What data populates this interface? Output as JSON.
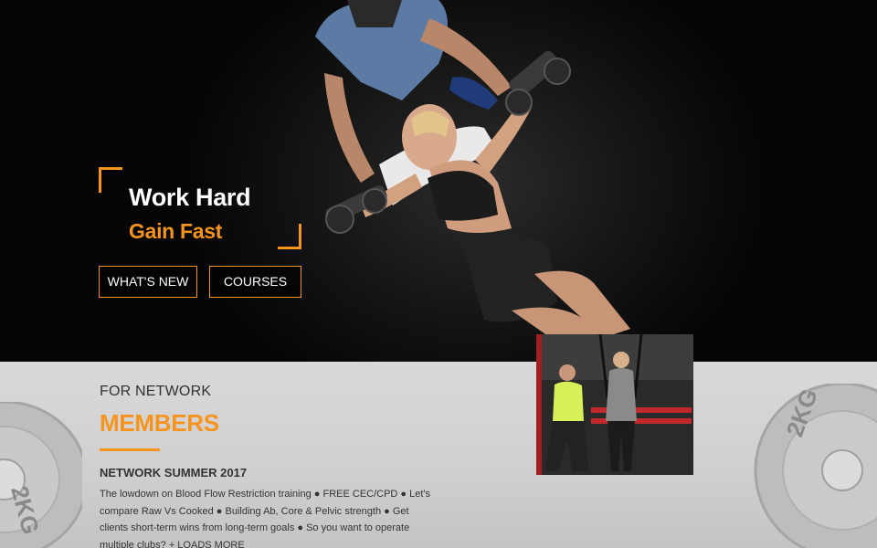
{
  "hero": {
    "headline_line1": "Work Hard",
    "headline_line2": "Gain Fast",
    "buttons": {
      "whats_new": "WHAT'S NEW",
      "courses": "COURSES"
    },
    "photo": "woman-dumbbell-fly-with-trainer-photo"
  },
  "members_section": {
    "kicker": "FOR NETWORK",
    "title": "MEMBERS",
    "issue_title": "NETWORK SUMMER 2017",
    "issue_summary": "The lowdown on Blood Flow Restriction training ● FREE CEC/CPD ● Let's compare Raw Vs Cooked ● Building Ab, Core & Pelvic strength ● Get clients short-term wins from long-term goals ● So you want to operate multiple clubs?",
    "more_link": "+ LOADS MORE",
    "plate_right_label": "2KG",
    "plate_left_label": "2KG",
    "thumbnail": "trx-suspension-training-photo"
  },
  "colors": {
    "accent": "#f7941d",
    "hero_bg": "#0a0a0a",
    "section_bg": "#d4d4d4",
    "text_dark": "#333333"
  }
}
